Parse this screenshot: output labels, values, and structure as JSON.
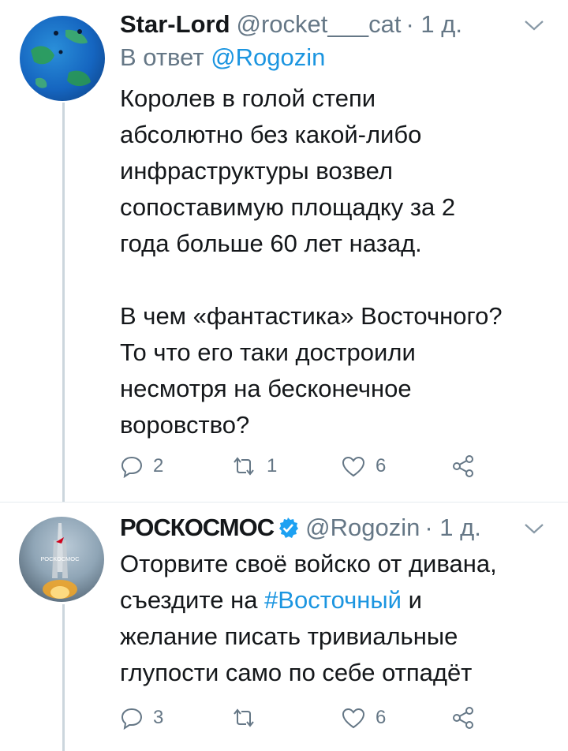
{
  "tweets": [
    {
      "name": "Star-Lord",
      "handle": "@rocket___cat",
      "time": "· 1 д.",
      "reply_prefix": "В ответ",
      "reply_mention": "@Rogozin",
      "text": "Королев в голой степи\nабсолютно без какой-либо\nинфраструктуры возвел\nсопоставимую площадку за 2\nгода больше 60 лет назад.\n\nВ чем «фантастика» Восточного?\nТо что его таки достроили\nнесмотря на бесконечное\nворовство?",
      "replies": "2",
      "retweets": "1",
      "likes": "6"
    },
    {
      "name": "РОСКОСМОС",
      "handle": "@Rogozin",
      "time": "· 1 д.",
      "text_before": "Оторвите своё войско от дивана,\nсъездите на ",
      "hashtag": "#Восточный",
      "text_after": " и\nжелание писать тривиальные\nглупости само по себе отпадёт",
      "replies": "3",
      "retweets": "",
      "likes": "6",
      "avatar_caption": "РОСКОСМОС"
    }
  ],
  "colors": {
    "link": "#1b95e0",
    "muted": "#657786",
    "text": "#14171a",
    "thread_line": "#ccd6dd"
  },
  "icons": [
    "chevron-down-icon",
    "reply-icon",
    "retweet-icon",
    "like-icon",
    "share-icon",
    "verified-badge-icon"
  ]
}
